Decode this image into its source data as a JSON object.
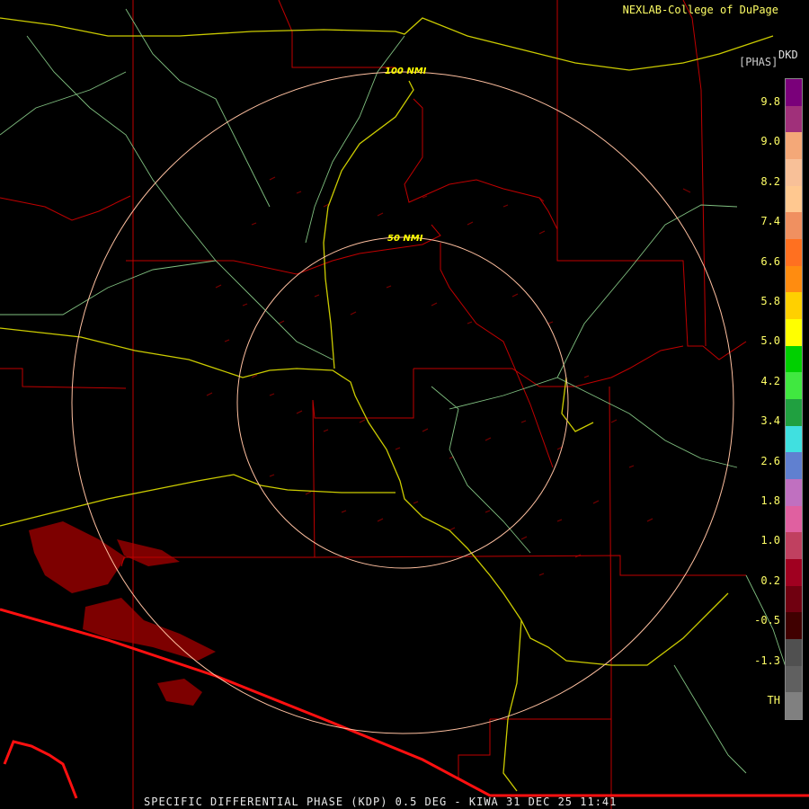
{
  "credit": "NEXLAB-College of DuPage",
  "legend": {
    "units": "DKD",
    "title": "[PHAS]",
    "ticks": [
      "9.8",
      "9.0",
      "8.2",
      "7.4",
      "6.6",
      "5.8",
      "5.0",
      "4.2",
      "3.4",
      "2.6",
      "1.8",
      "1.0",
      "0.2",
      "-0.5",
      "-1.3",
      "TH"
    ],
    "colors": [
      "#7a007a",
      "#a0307a",
      "#f4a878",
      "#f8c098",
      "#ffc890",
      "#f09060",
      "#ff7020",
      "#ff8c10",
      "#ffd000",
      "#ffff00",
      "#00d000",
      "#40e840",
      "#20a040",
      "#40e0e0",
      "#6080d0",
      "#c070c0",
      "#e060a0",
      "#c04060",
      "#a00020",
      "#700010",
      "#400000",
      "#505050",
      "#606060",
      "#808080"
    ]
  },
  "rings": [
    {
      "label": "100 NMI"
    },
    {
      "label": "50 NMI"
    }
  ],
  "caption": "SPECIFIC DIFFERENTIAL PHASE (KDP) 0.5 DEG - KIWA 31 DEC 25 11:41"
}
